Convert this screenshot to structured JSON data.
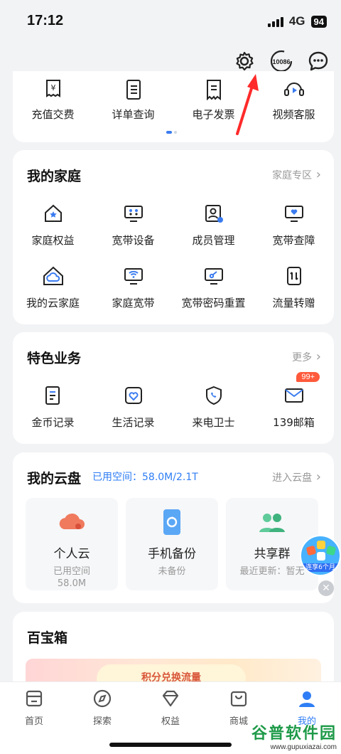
{
  "status": {
    "time": "17:12",
    "network": "4G",
    "battery": "94"
  },
  "topbar": {
    "service_code": "10086"
  },
  "quick_actions": [
    {
      "label": "充值交费",
      "icon": "recharge-icon"
    },
    {
      "label": "详单查询",
      "icon": "bill-list-icon"
    },
    {
      "label": "电子发票",
      "icon": "invoice-icon"
    },
    {
      "label": "视频客服",
      "icon": "video-service-icon"
    }
  ],
  "family": {
    "title": "我的家庭",
    "link": "家庭专区",
    "items": [
      {
        "label": "家庭权益",
        "icon": "home-star-icon"
      },
      {
        "label": "宽带设备",
        "icon": "broadband-device-icon"
      },
      {
        "label": "成员管理",
        "icon": "member-manage-icon"
      },
      {
        "label": "宽带查障",
        "icon": "broadband-diagnose-icon"
      },
      {
        "label": "我的云家庭",
        "icon": "cloud-home-icon"
      },
      {
        "label": "家庭宽带",
        "icon": "wifi-monitor-icon"
      },
      {
        "label": "宽带密码重置",
        "icon": "password-reset-icon"
      },
      {
        "label": "流量转赠",
        "icon": "data-transfer-icon"
      }
    ]
  },
  "featured": {
    "title": "特色业务",
    "link": "更多",
    "items": [
      {
        "label": "金币记录",
        "icon": "coin-record-icon"
      },
      {
        "label": "生活记录",
        "icon": "life-record-icon"
      },
      {
        "label": "来电卫士",
        "icon": "call-guard-icon"
      },
      {
        "label": "139邮箱",
        "icon": "mailbox-icon",
        "badge": "99+"
      }
    ]
  },
  "cloud": {
    "title": "我的云盘",
    "used_space": "已用空间：58.0M/2.1T",
    "link": "进入云盘",
    "tiles": [
      {
        "title": "个人云",
        "sub1": "已用空间",
        "sub2": "58.0M",
        "icon": "personal-cloud-icon"
      },
      {
        "title": "手机备份",
        "sub1": "未备份",
        "sub2": "",
        "icon": "phone-backup-icon"
      },
      {
        "title": "共享群",
        "sub1": "最近更新：暂无",
        "sub2": "",
        "icon": "share-group-icon"
      }
    ]
  },
  "toolbox": {
    "title": "百宝箱",
    "banner_text": "积分兑换流量"
  },
  "float_ad": {
    "label": "连享6个月"
  },
  "tabs": [
    {
      "label": "首页",
      "icon": "home-icon",
      "active": false
    },
    {
      "label": "探索",
      "icon": "compass-icon",
      "active": false
    },
    {
      "label": "权益",
      "icon": "diamond-icon",
      "active": false
    },
    {
      "label": "商城",
      "icon": "shop-icon",
      "active": false
    },
    {
      "label": "我的",
      "icon": "profile-icon",
      "active": true
    }
  ],
  "watermark": {
    "brand": "谷普软件园",
    "url": "www.gupuxiazai.com"
  },
  "colors": {
    "accent": "#2f7ef5",
    "badge": "#ff5a3c",
    "arrow": "#ff2a2a"
  }
}
